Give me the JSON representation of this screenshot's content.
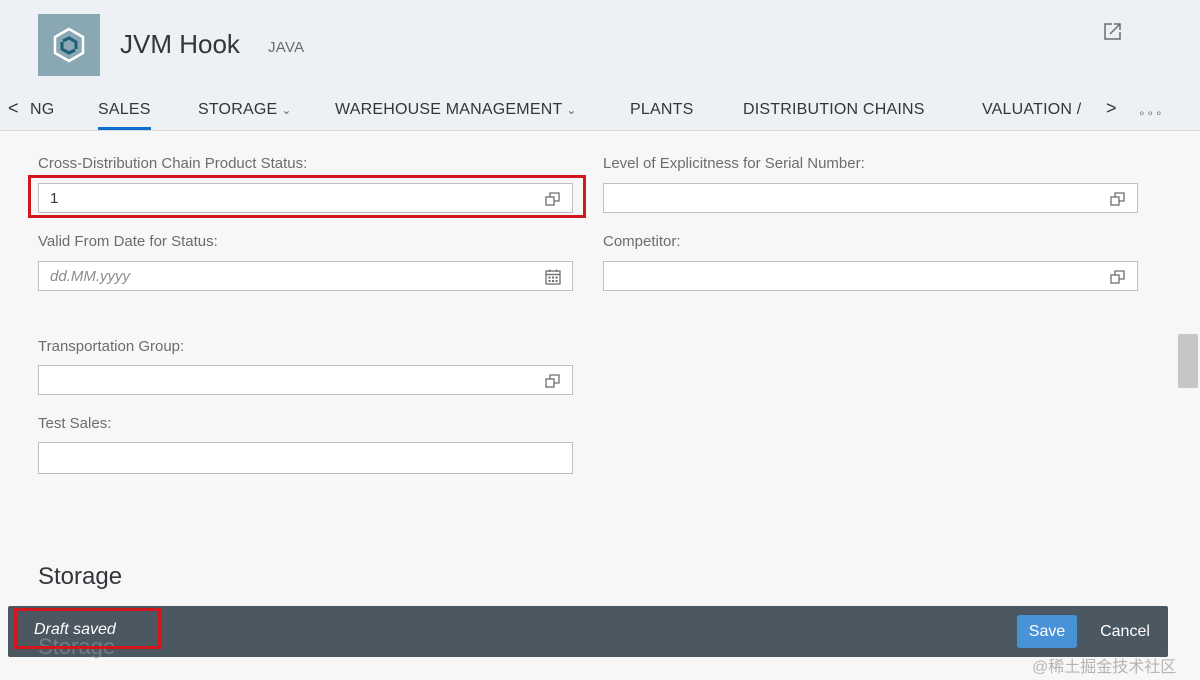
{
  "header": {
    "title": "JVM Hook",
    "subtitle": "JAVA",
    "avatar_icon": "product-cube-icon",
    "share_icon": "share-icon"
  },
  "tabs": {
    "prev_label": "<",
    "next_label": ">",
    "overflow": "∘∘∘",
    "items": [
      {
        "label": "NG"
      },
      {
        "label": "SALES",
        "selected": true
      },
      {
        "label": "STORAGE"
      },
      {
        "label": "WAREHOUSE MANAGEMENT"
      },
      {
        "label": "PLANTS"
      },
      {
        "label": "DISTRIBUTION CHAINS"
      },
      {
        "label": "VALUATION /"
      }
    ]
  },
  "form": {
    "cross_dist_status": {
      "label": "Cross-Distribution Chain Product Status:",
      "value": "1"
    },
    "valid_from": {
      "label": "Valid From Date for Status:",
      "placeholder": "dd.MM.yyyy"
    },
    "transport_group": {
      "label": "Transportation Group:",
      "value": ""
    },
    "test_sales": {
      "label": "Test Sales:",
      "value": ""
    },
    "serial_explicitness": {
      "label": "Level of Explicitness for Serial Number:",
      "value": ""
    },
    "competitor": {
      "label": "Competitor:",
      "value": ""
    }
  },
  "section": {
    "title": "Storage",
    "behind_footer": "Storage"
  },
  "footer": {
    "message": "Draft saved",
    "save_label": "Save",
    "cancel_label": "Cancel"
  },
  "watermark": "@稀土掘金技术社区",
  "colors": {
    "accent": "#0a6ed1",
    "save_button": "#4893d8",
    "footer_bg": "#4b5761",
    "highlight": "#d0181c"
  }
}
